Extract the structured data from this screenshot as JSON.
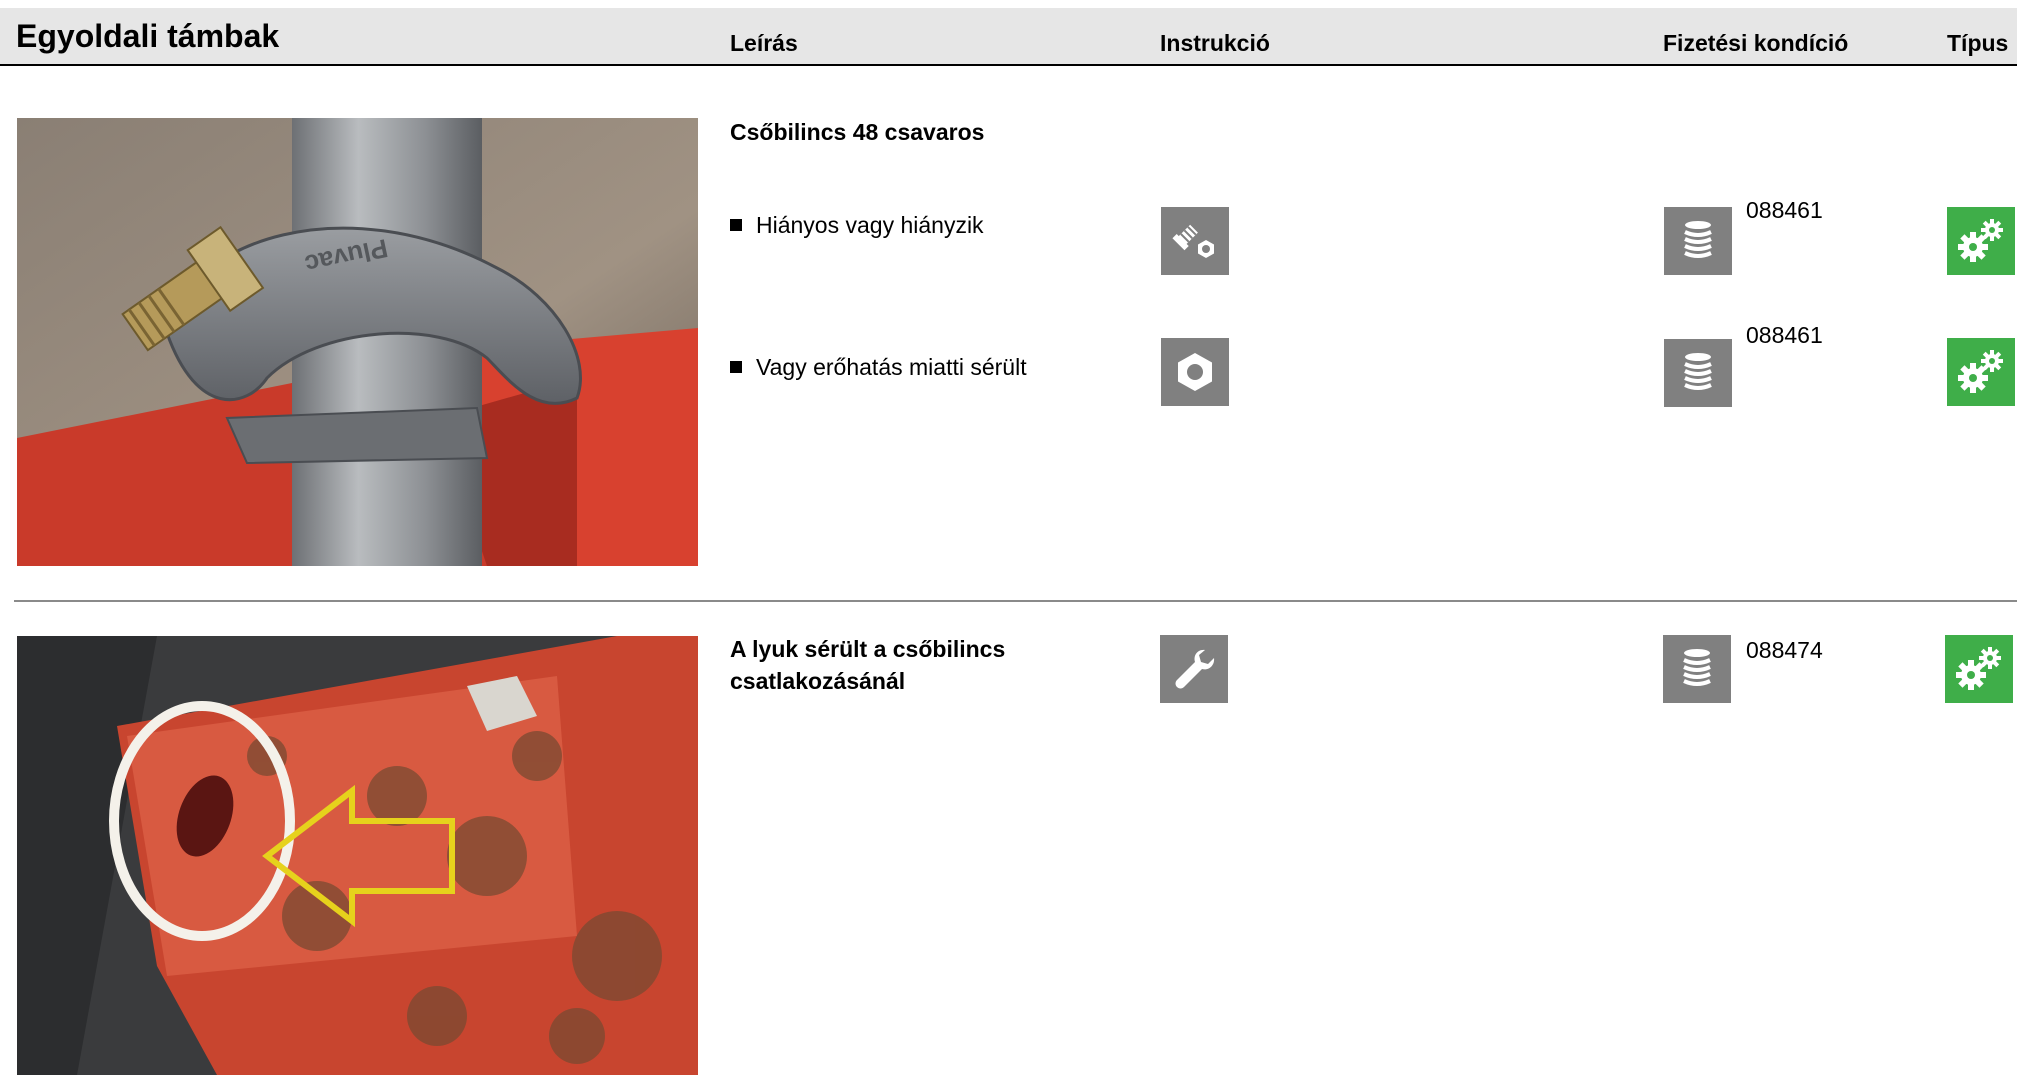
{
  "header": {
    "title": "Egyoldali támbak",
    "col_description": "Leírás",
    "col_instruction": "Instrukció",
    "col_payment": "Fizetési kondíció",
    "col_type": "Típus"
  },
  "sections": [
    {
      "title": "Csőbilincs 48 csavaros",
      "rows": [
        {
          "text": "Hiányos vagy hiányzik",
          "instruction_icon": "bolt-nut-icon",
          "payment_icon": "stack-icon",
          "code": "088461",
          "type_icon": "gears-icon"
        },
        {
          "text": "Vagy erőhatás miatti sérült",
          "instruction_icon": "nut-icon",
          "payment_icon": "stack-icon",
          "code": "088461",
          "type_icon": "gears-icon"
        }
      ]
    },
    {
      "title_line1": "A lyuk sérült a csőbilincs",
      "title_line2": "csatlakozásánál",
      "instruction_icon": "wrench-icon",
      "payment_icon": "stack-icon",
      "code": "088474",
      "type_icon": "gears-icon"
    }
  ],
  "colors": {
    "header_bg": "#e6e6e6",
    "icon_gray": "#808080",
    "icon_green": "#3fae49"
  }
}
